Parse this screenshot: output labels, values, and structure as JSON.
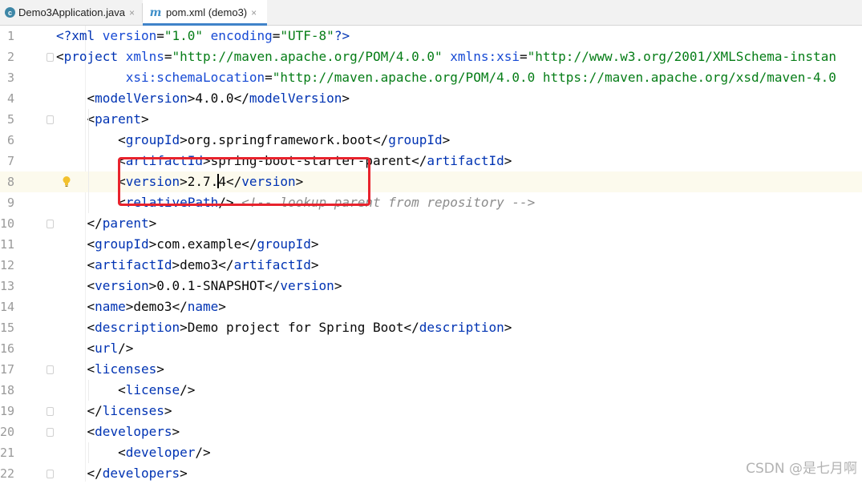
{
  "tabs": [
    {
      "label": "Demo3Application.java",
      "icon": "java-class-icon"
    },
    {
      "label": "pom.xml (demo3)",
      "icon": "maven-icon",
      "active": true
    }
  ],
  "close_glyph": "×",
  "maven_glyph": "m",
  "current_line": 8,
  "lines": [
    {
      "n": "1",
      "fold": false,
      "tokens": [
        [
          "pi",
          "<?"
        ],
        [
          "tag",
          "xml "
        ],
        [
          "attr",
          "version"
        ],
        [
          "text",
          "="
        ],
        [
          "str",
          "\"1.0\" "
        ],
        [
          "attr",
          "encoding"
        ],
        [
          "text",
          "="
        ],
        [
          "str",
          "\"UTF-8\""
        ],
        [
          "pi",
          "?>"
        ]
      ]
    },
    {
      "n": "2",
      "fold": true,
      "tokens": [
        [
          "text",
          "<"
        ],
        [
          "tag",
          "project "
        ],
        [
          "attr",
          "xmlns"
        ],
        [
          "text",
          "="
        ],
        [
          "str",
          "\"http://maven.apache.org/POM/4.0.0\" "
        ],
        [
          "attr",
          "xmlns:xsi"
        ],
        [
          "text",
          "="
        ],
        [
          "str",
          "\"http://www.w3.org/2001/XMLSchema-instan"
        ]
      ]
    },
    {
      "n": "3",
      "fold": false,
      "tokens": [
        [
          "text",
          "         "
        ],
        [
          "attr",
          "xsi:schemaLocation"
        ],
        [
          "text",
          "="
        ],
        [
          "str",
          "\"http://maven.apache.org/POM/4.0.0 https://maven.apache.org/xsd/maven-4.0"
        ]
      ]
    },
    {
      "n": "4",
      "fold": false,
      "tokens": [
        [
          "text",
          "    <"
        ],
        [
          "tag",
          "modelVersion"
        ],
        [
          "text",
          ">4.0.0</"
        ],
        [
          "tag",
          "modelVersion"
        ],
        [
          "text",
          ">"
        ]
      ]
    },
    {
      "n": "5",
      "fold": true,
      "tokens": [
        [
          "text",
          "    <"
        ],
        [
          "tag",
          "parent"
        ],
        [
          "text",
          ">"
        ]
      ]
    },
    {
      "n": "6",
      "fold": false,
      "tokens": [
        [
          "text",
          "        <"
        ],
        [
          "tag",
          "groupId"
        ],
        [
          "text",
          ">org.springframework.boot</"
        ],
        [
          "tag",
          "groupId"
        ],
        [
          "text",
          ">"
        ]
      ]
    },
    {
      "n": "7",
      "fold": false,
      "tokens": [
        [
          "text",
          "        <"
        ],
        [
          "tag",
          "artifactId"
        ],
        [
          "text",
          ">spring-boot-starter-parent</"
        ],
        [
          "tag",
          "artifactId"
        ],
        [
          "text",
          ">"
        ]
      ]
    },
    {
      "n": "8",
      "fold": false,
      "bulb": true,
      "tokens": [
        [
          "text",
          "        <"
        ],
        [
          "tag",
          "version"
        ],
        [
          "text",
          ">2.7."
        ],
        [
          "caret",
          ""
        ],
        [
          "text",
          "4</"
        ],
        [
          "tag",
          "version"
        ],
        [
          "text",
          ">"
        ]
      ]
    },
    {
      "n": "9",
      "fold": false,
      "tokens": [
        [
          "text",
          "        <"
        ],
        [
          "tag",
          "relativePath"
        ],
        [
          "text",
          "/> "
        ],
        [
          "comment",
          "<!-- lookup parent from repository -->"
        ]
      ]
    },
    {
      "n": "10",
      "fold": true,
      "tokens": [
        [
          "text",
          "    </"
        ],
        [
          "tag",
          "parent"
        ],
        [
          "text",
          ">"
        ]
      ]
    },
    {
      "n": "11",
      "fold": false,
      "tokens": [
        [
          "text",
          "    <"
        ],
        [
          "tag",
          "groupId"
        ],
        [
          "text",
          ">com.example</"
        ],
        [
          "tag",
          "groupId"
        ],
        [
          "text",
          ">"
        ]
      ]
    },
    {
      "n": "12",
      "fold": false,
      "tokens": [
        [
          "text",
          "    <"
        ],
        [
          "tag",
          "artifactId"
        ],
        [
          "text",
          ">demo3</"
        ],
        [
          "tag",
          "artifactId"
        ],
        [
          "text",
          ">"
        ]
      ]
    },
    {
      "n": "13",
      "fold": false,
      "tokens": [
        [
          "text",
          "    <"
        ],
        [
          "tag",
          "version"
        ],
        [
          "text",
          ">0.0.1-SNAPSHOT</"
        ],
        [
          "tag",
          "version"
        ],
        [
          "text",
          ">"
        ]
      ]
    },
    {
      "n": "14",
      "fold": false,
      "tokens": [
        [
          "text",
          "    <"
        ],
        [
          "tag",
          "name"
        ],
        [
          "text",
          ">demo3</"
        ],
        [
          "tag",
          "name"
        ],
        [
          "text",
          ">"
        ]
      ]
    },
    {
      "n": "15",
      "fold": false,
      "tokens": [
        [
          "text",
          "    <"
        ],
        [
          "tag",
          "description"
        ],
        [
          "text",
          ">Demo project for Spring Boot</"
        ],
        [
          "tag",
          "description"
        ],
        [
          "text",
          ">"
        ]
      ]
    },
    {
      "n": "16",
      "fold": false,
      "tokens": [
        [
          "text",
          "    <"
        ],
        [
          "tag",
          "url"
        ],
        [
          "text",
          "/>"
        ]
      ]
    },
    {
      "n": "17",
      "fold": true,
      "tokens": [
        [
          "text",
          "    <"
        ],
        [
          "tag",
          "licenses"
        ],
        [
          "text",
          ">"
        ]
      ]
    },
    {
      "n": "18",
      "fold": false,
      "tokens": [
        [
          "text",
          "        <"
        ],
        [
          "tag",
          "license"
        ],
        [
          "text",
          "/>"
        ]
      ]
    },
    {
      "n": "19",
      "fold": true,
      "tokens": [
        [
          "text",
          "    </"
        ],
        [
          "tag",
          "licenses"
        ],
        [
          "text",
          ">"
        ]
      ]
    },
    {
      "n": "20",
      "fold": true,
      "tokens": [
        [
          "text",
          "    <"
        ],
        [
          "tag",
          "developers"
        ],
        [
          "text",
          ">"
        ]
      ]
    },
    {
      "n": "21",
      "fold": false,
      "tokens": [
        [
          "text",
          "        <"
        ],
        [
          "tag",
          "developer"
        ],
        [
          "text",
          "/>"
        ]
      ]
    },
    {
      "n": "22",
      "fold": true,
      "tokens": [
        [
          "text",
          "    </"
        ],
        [
          "tag",
          "developers"
        ],
        [
          "text",
          ">"
        ]
      ]
    }
  ],
  "watermark": "CSDN @是七月啊",
  "colors": {
    "tag": "#0033b3",
    "string": "#067d17",
    "highlight_box": "#e8232d",
    "current_line": "#fcfaed"
  }
}
